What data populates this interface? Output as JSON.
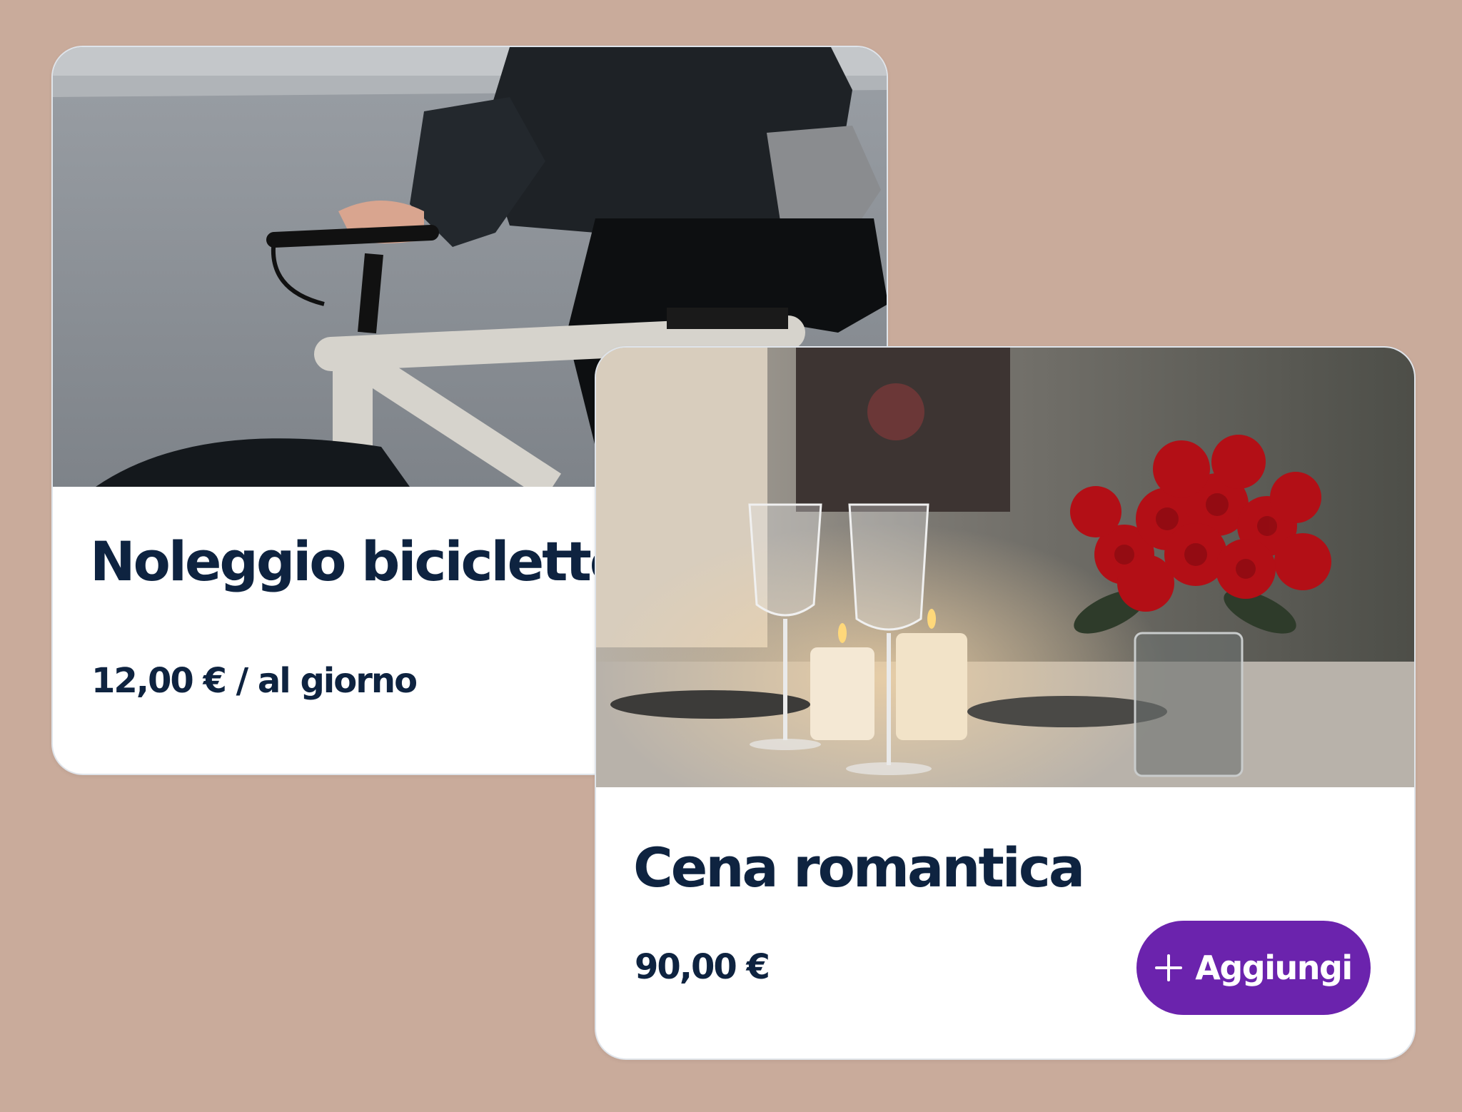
{
  "cards": [
    {
      "title": "Noleggio biciclette",
      "price": "12,00 € / al giorno",
      "image": "bicycle-rider-photo"
    },
    {
      "title": "Cena romantica",
      "price": "90,00 €",
      "image": "candlelit-dinner-roses-photo",
      "button_label": "Aggiungi",
      "button_icon": "plus-icon"
    }
  ],
  "colors": {
    "background": "#c9ab9b",
    "card": "#ffffff",
    "text": "#0e2340",
    "button": "#6b23ad"
  }
}
